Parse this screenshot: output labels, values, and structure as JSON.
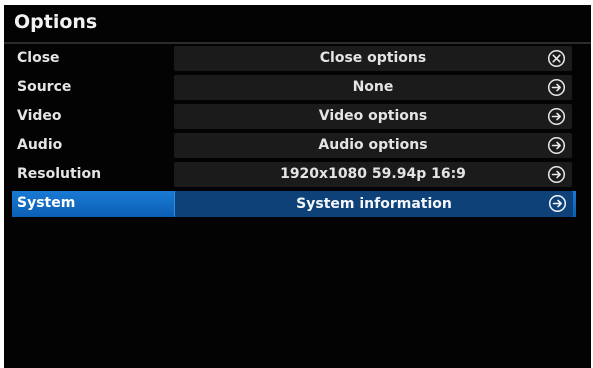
{
  "window": {
    "title": "Options"
  },
  "menu": {
    "items": [
      {
        "label": "Close",
        "value": "Close options",
        "icon": "close-circle-icon",
        "selected": false
      },
      {
        "label": "Source",
        "value": "None",
        "icon": "arrow-right-circle-icon",
        "selected": false
      },
      {
        "label": "Video",
        "value": "Video options",
        "icon": "arrow-right-circle-icon",
        "selected": false
      },
      {
        "label": "Audio",
        "value": "Audio options",
        "icon": "arrow-right-circle-icon",
        "selected": false
      },
      {
        "label": "Resolution",
        "value": "1920x1080 59.94p 16:9",
        "icon": "arrow-right-circle-icon",
        "selected": false
      },
      {
        "label": "System",
        "value": "System information",
        "icon": "arrow-right-circle-icon",
        "selected": true
      }
    ]
  },
  "colors": {
    "background": "#030303",
    "row_value_background": "#1b1b1b",
    "text": "#e4e4e4",
    "selection": "#1670c8"
  }
}
